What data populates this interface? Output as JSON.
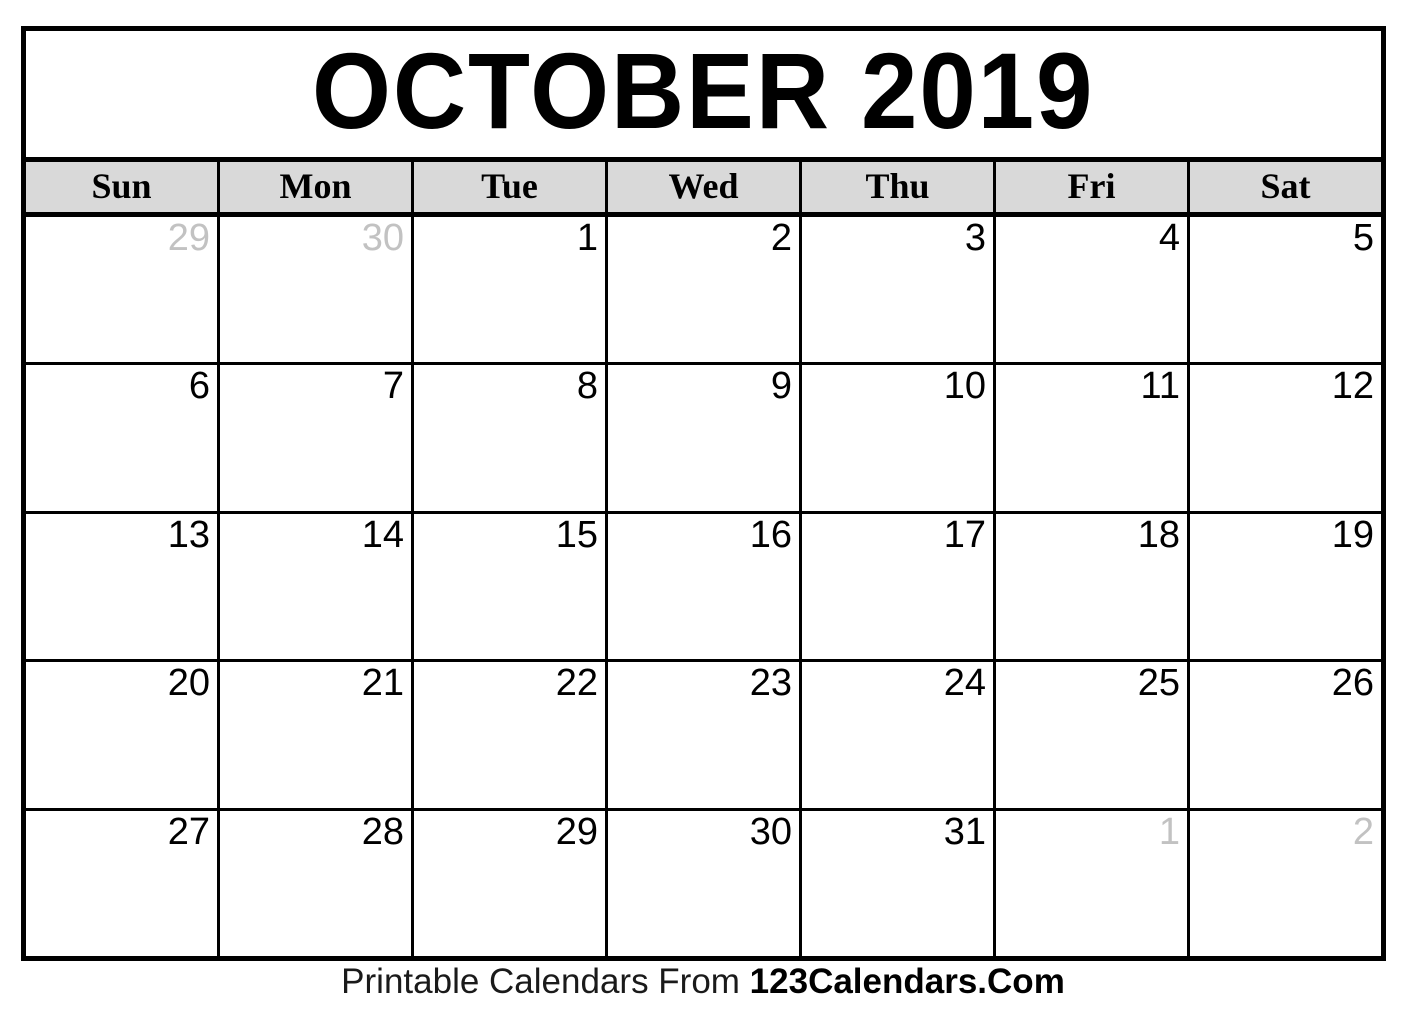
{
  "document": {
    "title": "OCTOBER 2019",
    "month_name": "OCTOBER",
    "year": "2019"
  },
  "colors": {
    "frame_border": "#000000",
    "header_background": "#d9d9d9",
    "in_month_text": "#000000",
    "out_of_month_text": "#c2c2c2",
    "page_background": "#ffffff"
  },
  "weekdays": [
    {
      "label": "Sun"
    },
    {
      "label": "Mon"
    },
    {
      "label": "Tue"
    },
    {
      "label": "Wed"
    },
    {
      "label": "Thu"
    },
    {
      "label": "Fri"
    },
    {
      "label": "Sat"
    }
  ],
  "weeks": [
    {
      "days": [
        {
          "number": "29",
          "in_month": false
        },
        {
          "number": "30",
          "in_month": false
        },
        {
          "number": "1",
          "in_month": true
        },
        {
          "number": "2",
          "in_month": true
        },
        {
          "number": "3",
          "in_month": true
        },
        {
          "number": "4",
          "in_month": true
        },
        {
          "number": "5",
          "in_month": true
        }
      ]
    },
    {
      "days": [
        {
          "number": "6",
          "in_month": true
        },
        {
          "number": "7",
          "in_month": true
        },
        {
          "number": "8",
          "in_month": true
        },
        {
          "number": "9",
          "in_month": true
        },
        {
          "number": "10",
          "in_month": true
        },
        {
          "number": "11",
          "in_month": true
        },
        {
          "number": "12",
          "in_month": true
        }
      ]
    },
    {
      "days": [
        {
          "number": "13",
          "in_month": true
        },
        {
          "number": "14",
          "in_month": true
        },
        {
          "number": "15",
          "in_month": true
        },
        {
          "number": "16",
          "in_month": true
        },
        {
          "number": "17",
          "in_month": true
        },
        {
          "number": "18",
          "in_month": true
        },
        {
          "number": "19",
          "in_month": true
        }
      ]
    },
    {
      "days": [
        {
          "number": "20",
          "in_month": true
        },
        {
          "number": "21",
          "in_month": true
        },
        {
          "number": "22",
          "in_month": true
        },
        {
          "number": "23",
          "in_month": true
        },
        {
          "number": "24",
          "in_month": true
        },
        {
          "number": "25",
          "in_month": true
        },
        {
          "number": "26",
          "in_month": true
        }
      ]
    },
    {
      "days": [
        {
          "number": "27",
          "in_month": true
        },
        {
          "number": "28",
          "in_month": true
        },
        {
          "number": "29",
          "in_month": true
        },
        {
          "number": "30",
          "in_month": true
        },
        {
          "number": "31",
          "in_month": true
        },
        {
          "number": "1",
          "in_month": false
        },
        {
          "number": "2",
          "in_month": false
        }
      ]
    }
  ],
  "footer": {
    "prefix": "Printable Calendars From ",
    "brand": "123Calendars.Com"
  }
}
